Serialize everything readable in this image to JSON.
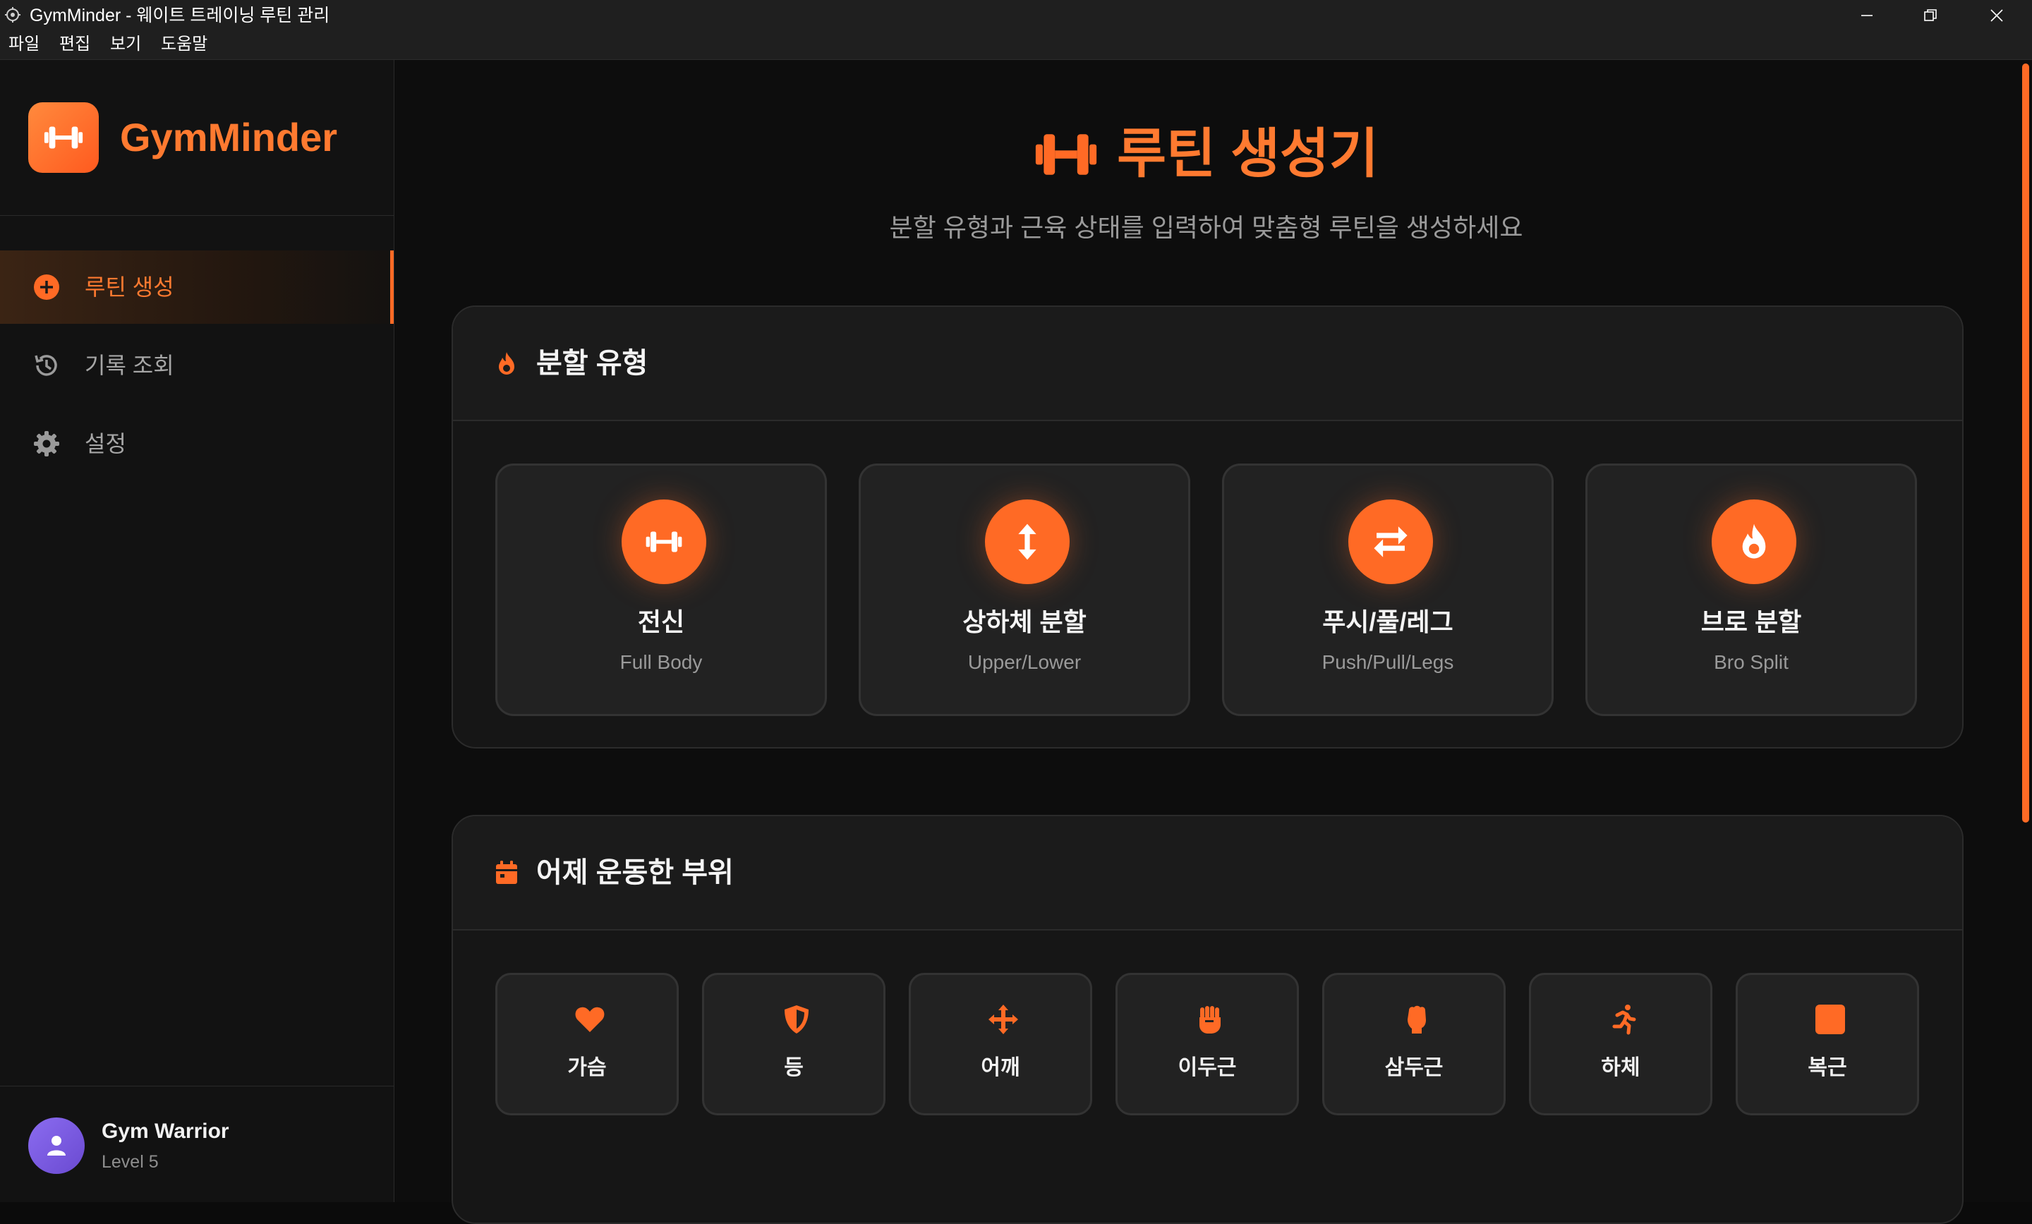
{
  "window": {
    "title": "GymMinder - 웨이트 트레이닝 루틴 관리",
    "menu": [
      "파일",
      "편집",
      "보기",
      "도움말"
    ]
  },
  "sidebar": {
    "brand": "GymMinder",
    "items": [
      {
        "label": "루틴 생성",
        "icon": "plus-circle-icon",
        "active": true
      },
      {
        "label": "기록 조회",
        "icon": "history-icon",
        "active": false
      },
      {
        "label": "설정",
        "icon": "gear-icon",
        "active": false
      }
    ],
    "user": {
      "name": "Gym Warrior",
      "level": "Level 5"
    }
  },
  "main": {
    "title": "루틴 생성기",
    "subtitle": "분할 유형과 근육 상태를 입력하여 맞춤형 루틴을 생성하세요",
    "split_section": {
      "title": "분할 유형",
      "options": [
        {
          "name": "전신",
          "sub": "Full Body",
          "icon": "dumbbell-icon"
        },
        {
          "name": "상하체 분할",
          "sub": "Upper/Lower",
          "icon": "arrows-vertical-icon"
        },
        {
          "name": "푸시/풀/레그",
          "sub": "Push/Pull/Legs",
          "icon": "exchange-icon"
        },
        {
          "name": "브로 분할",
          "sub": "Bro Split",
          "icon": "fire-icon"
        }
      ]
    },
    "muscle_section": {
      "title": "어제 운동한 부위",
      "options": [
        {
          "name": "가슴",
          "icon": "heart-icon"
        },
        {
          "name": "등",
          "icon": "shield-icon"
        },
        {
          "name": "어깨",
          "icon": "arrows-cross-icon"
        },
        {
          "name": "이두근",
          "icon": "fist-icon"
        },
        {
          "name": "삼두근",
          "icon": "hand-back-fist-icon"
        },
        {
          "name": "하체",
          "icon": "running-icon"
        },
        {
          "name": "복근",
          "icon": "square-icon"
        }
      ]
    }
  },
  "colors": {
    "accent": "#ff6a25",
    "accent_text": "#ff7a30",
    "background": "#0d0d0d",
    "card": "#222222",
    "avatar": "#7b5ce6"
  }
}
